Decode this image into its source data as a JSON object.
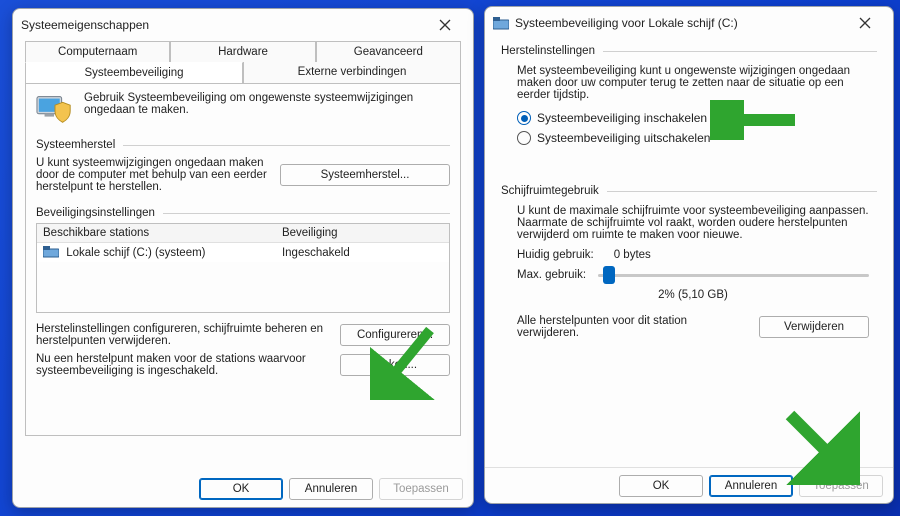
{
  "left": {
    "title": "Systeemeigenschappen",
    "tabs": {
      "top1": "Computernaam",
      "top2": "Hardware",
      "top3": "Geavanceerd",
      "bot1": "Systeembeveiliging",
      "bot2": "Externe verbindingen"
    },
    "intro": "Gebruik Systeembeveiliging om ongewenste systeemwijzigingen ongedaan te maken.",
    "group_restore": "Systeemherstel",
    "restore_text": "U kunt systeemwijzigingen ongedaan maken door de computer met behulp van een eerder herstelpunt te herstellen.",
    "btn_restore": "Systeemherstel...",
    "group_prot": "Beveiligingsinstellingen",
    "col_a": "Beschikbare stations",
    "col_b": "Beveiliging",
    "drive": "Lokale schijf (C:) (systeem)",
    "drive_state": "Ingeschakeld",
    "cfg_text": "Herstelinstellingen configureren, schijfruimte beheren en herstelpunten verwijderen.",
    "btn_cfg": "Configureren...",
    "make_text": "Nu een herstelpunt maken voor de stations waarvoor systeembeveiliging is ingeschakeld.",
    "btn_make": "Maken...",
    "ok": "OK",
    "cancel": "Annuleren",
    "apply": "Toepassen"
  },
  "right": {
    "title": "Systeembeveiliging voor Lokale schijf (C:)",
    "group_restore": "Herstelinstellingen",
    "restore_blurb": "Met systeembeveiliging kunt u ongewenste wijzigingen ongedaan maken door uw computer terug te zetten naar de situatie op een eerder tijdstip.",
    "radio_on": "Systeembeveiliging inschakelen",
    "radio_off": "Systeembeveiliging uitschakelen",
    "group_disk": "Schijfruimtegebruik",
    "disk_blurb": "U kunt de maximale schijfruimte voor systeembeveiliging aanpassen. Naarmate de schijfruimte vol raakt, worden oudere herstelpunten verwijderd om ruimte te maken voor nieuwe.",
    "cur_label": "Huidig gebruik:",
    "cur_value": "0 bytes",
    "max_label": "Max. gebruik:",
    "usage_value": "2% (5,10 GB)",
    "del_text": "Alle herstelpunten voor dit station verwijderen.",
    "btn_del": "Verwijderen",
    "ok": "OK",
    "cancel": "Annuleren",
    "apply": "Toepassen"
  }
}
